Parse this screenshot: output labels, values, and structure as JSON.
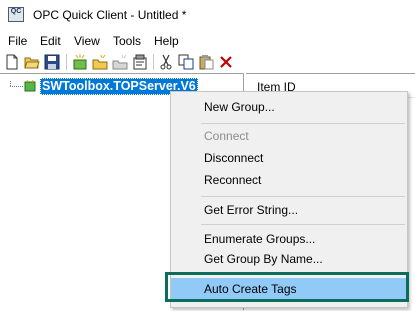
{
  "window": {
    "title": "OPC Quick Client - Untitled *",
    "icon_text": "QC"
  },
  "menubar": {
    "items": [
      "File",
      "Edit",
      "View",
      "Tools",
      "Help"
    ]
  },
  "toolbar": {
    "buttons": [
      "new-icon",
      "open-icon",
      "save-icon",
      "new-server-icon",
      "new-group-icon",
      "new-item-icon",
      "properties-icon",
      "cut-icon",
      "copy-icon",
      "paste-icon",
      "delete-icon"
    ]
  },
  "tree": {
    "server_label": "SWToolbox.TOPServer.V6"
  },
  "list": {
    "column_header": "Item ID"
  },
  "context_menu": {
    "items": [
      {
        "label": "New Group...",
        "enabled": true
      },
      {
        "label": "Connect",
        "enabled": false
      },
      {
        "label": "Disconnect",
        "enabled": true
      },
      {
        "label": "Reconnect",
        "enabled": true
      },
      {
        "label": "Get Error String...",
        "enabled": true
      },
      {
        "label": "Enumerate Groups...",
        "enabled": true
      },
      {
        "label": "Get Group By Name...",
        "enabled": true
      },
      {
        "label": "Auto Create Tags",
        "enabled": true,
        "highlighted": true
      }
    ]
  },
  "colors": {
    "selection": "#0078d7",
    "menu_highlight": "#91c9f7",
    "callout_border": "#0c6e5a",
    "delete_red": "#c00000"
  }
}
